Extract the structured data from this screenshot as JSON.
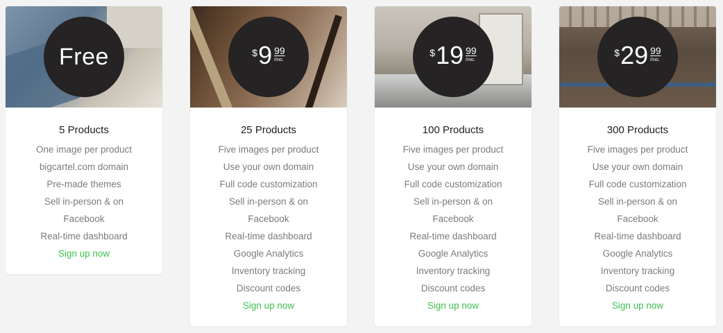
{
  "plans": [
    {
      "price_label": "Free",
      "title": "5 Products",
      "features": [
        "One image per product",
        "bigcartel.com domain",
        "Pre-made themes",
        "Sell in-person & on",
        "Facebook",
        "Real-time dashboard"
      ],
      "cta": "Sign up now"
    },
    {
      "currency": "$",
      "amount": "9",
      "cents": "99",
      "period": "/mo.",
      "title": "25 Products",
      "features": [
        "Five images per product",
        "Use your own domain",
        "Full code customization",
        "Sell in-person & on",
        "Facebook",
        "Real-time dashboard",
        "Google Analytics",
        "Inventory tracking",
        "Discount codes"
      ],
      "cta": "Sign up now"
    },
    {
      "currency": "$",
      "amount": "19",
      "cents": "99",
      "period": "/mo.",
      "title": "100 Products",
      "features": [
        "Five images per product",
        "Use your own domain",
        "Full code customization",
        "Sell in-person & on",
        "Facebook",
        "Real-time dashboard",
        "Google Analytics",
        "Inventory tracking",
        "Discount codes"
      ],
      "cta": "Sign up now"
    },
    {
      "currency": "$",
      "amount": "29",
      "cents": "99",
      "period": "/mo.",
      "title": "300 Products",
      "features": [
        "Five images per product",
        "Use your own domain",
        "Full code customization",
        "Sell in-person & on",
        "Facebook",
        "Real-time dashboard",
        "Google Analytics",
        "Inventory tracking",
        "Discount codes"
      ],
      "cta": "Sign up now"
    }
  ],
  "colors": {
    "badge": "#252323",
    "cta": "#3fbf4f",
    "feature_text": "#7b7b7b",
    "title_text": "#1e1e1e"
  }
}
